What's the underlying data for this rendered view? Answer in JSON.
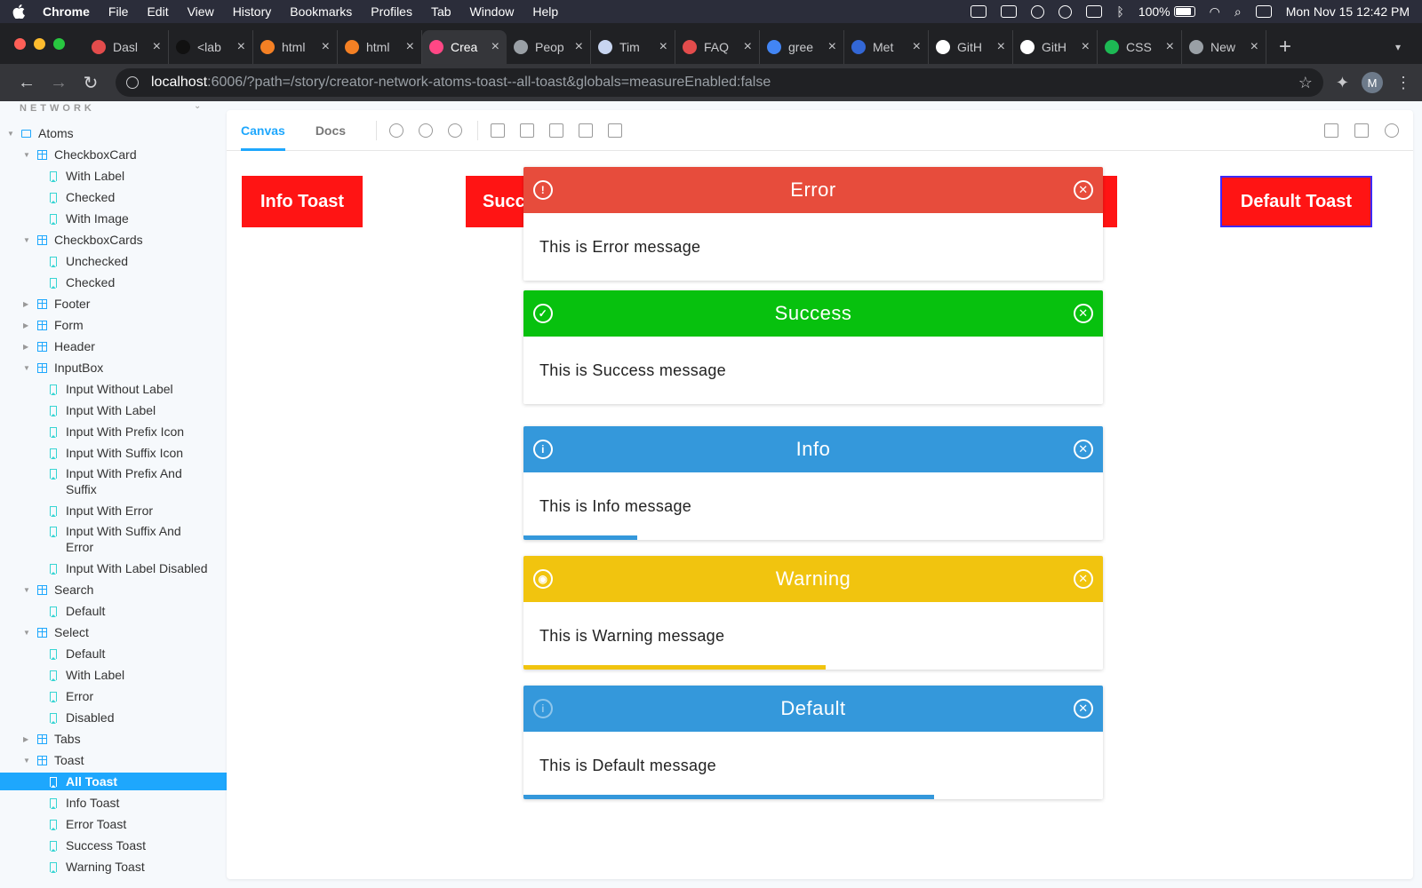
{
  "menubar": {
    "app": "Chrome",
    "items": [
      "File",
      "Edit",
      "View",
      "History",
      "Bookmarks",
      "Profiles",
      "Tab",
      "Window",
      "Help"
    ],
    "battery": "100%",
    "clock": "Mon Nov 15  12:42 PM"
  },
  "tabs": [
    {
      "title": "Dasl",
      "color": "#e34c4c"
    },
    {
      "title": "<lab",
      "color": "#111111"
    },
    {
      "title": "html",
      "color": "#f48024"
    },
    {
      "title": "html",
      "color": "#f48024"
    },
    {
      "title": "Crea",
      "color": "#ff4785",
      "active": true
    },
    {
      "title": "Peop",
      "color": "#9aa0a6"
    },
    {
      "title": "Tim",
      "color": "#c8d5f0"
    },
    {
      "title": "FAQ",
      "color": "#e34c4c"
    },
    {
      "title": "gree",
      "color": "#4285f4"
    },
    {
      "title": "Met",
      "color": "#3367d6"
    },
    {
      "title": "GitH",
      "color": "#ffffff"
    },
    {
      "title": "GitH",
      "color": "#ffffff"
    },
    {
      "title": "CSS",
      "color": "#1db954"
    },
    {
      "title": "New",
      "color": "#9aa0a6"
    }
  ],
  "address": {
    "host": "localhost",
    "path": ":6006/?path=/story/creator-network-atoms-toast--all-toast&globals=measureEnabled:false"
  },
  "avatar_letter": "M",
  "sidebar": {
    "heading": "NETWORK",
    "items": [
      {
        "label": "Atoms",
        "type": "folder",
        "level": 0,
        "expanded": true
      },
      {
        "label": "CheckboxCard",
        "type": "component",
        "level": 1,
        "expanded": true
      },
      {
        "label": "With Label",
        "type": "story",
        "level": 2
      },
      {
        "label": "Checked",
        "type": "story",
        "level": 2
      },
      {
        "label": "With Image",
        "type": "story",
        "level": 2
      },
      {
        "label": "CheckboxCards",
        "type": "component",
        "level": 1,
        "expanded": true
      },
      {
        "label": "Unchecked",
        "type": "story",
        "level": 2
      },
      {
        "label": "Checked",
        "type": "story",
        "level": 2
      },
      {
        "label": "Footer",
        "type": "component",
        "level": 1,
        "expanded": false
      },
      {
        "label": "Form",
        "type": "component",
        "level": 1,
        "expanded": false
      },
      {
        "label": "Header",
        "type": "component",
        "level": 1,
        "expanded": false
      },
      {
        "label": "InputBox",
        "type": "component",
        "level": 1,
        "expanded": true
      },
      {
        "label": "Input Without Label",
        "type": "story",
        "level": 2
      },
      {
        "label": "Input With Label",
        "type": "story",
        "level": 2
      },
      {
        "label": "Input With Prefix Icon",
        "type": "story",
        "level": 2
      },
      {
        "label": "Input With Suffix Icon",
        "type": "story",
        "level": 2
      },
      {
        "label": "Input With Prefix And Suffix",
        "type": "story",
        "level": 2,
        "multiline": true
      },
      {
        "label": "Input With Error",
        "type": "story",
        "level": 2
      },
      {
        "label": "Input With Suffix And Error",
        "type": "story",
        "level": 2,
        "multiline": true
      },
      {
        "label": "Input With Label Disabled",
        "type": "story",
        "level": 2
      },
      {
        "label": "Search",
        "type": "component",
        "level": 1,
        "expanded": true
      },
      {
        "label": "Default",
        "type": "story",
        "level": 2
      },
      {
        "label": "Select",
        "type": "component",
        "level": 1,
        "expanded": true
      },
      {
        "label": "Default",
        "type": "story",
        "level": 2
      },
      {
        "label": "With Label",
        "type": "story",
        "level": 2
      },
      {
        "label": "Error",
        "type": "story",
        "level": 2
      },
      {
        "label": "Disabled",
        "type": "story",
        "level": 2
      },
      {
        "label": "Tabs",
        "type": "component",
        "level": 1,
        "expanded": false
      },
      {
        "label": "Toast",
        "type": "component",
        "level": 1,
        "expanded": true
      },
      {
        "label": "All Toast",
        "type": "story",
        "level": 2,
        "selected": true
      },
      {
        "label": "Info Toast",
        "type": "story",
        "level": 2
      },
      {
        "label": "Error Toast",
        "type": "story",
        "level": 2
      },
      {
        "label": "Success Toast",
        "type": "story",
        "level": 2
      },
      {
        "label": "Warning Toast",
        "type": "story",
        "level": 2
      }
    ]
  },
  "storybook_toolbar": {
    "tabs": [
      "Canvas",
      "Docs"
    ],
    "active_tab": "Canvas"
  },
  "demo_buttons": {
    "info": "Info Toast",
    "success": "Succ",
    "default": "Default Toast"
  },
  "toasts": [
    {
      "title": "Error",
      "message": "This is Error message",
      "color": "#e74c3c",
      "icon": "exclamation-icon",
      "progress": 0
    },
    {
      "title": "Success",
      "message": "This is Success message",
      "color": "#07c10e",
      "icon": "check-icon",
      "progress": 0
    },
    {
      "title": "Info",
      "message": "This is Info message",
      "color": "#3498db",
      "icon": "info-icon",
      "progress": 0.196
    },
    {
      "title": "Warning",
      "message": "This is Warning message",
      "color": "#f1c40f",
      "icon": "broadcast-icon",
      "progress": 0.521
    },
    {
      "title": "Default",
      "message": "This is Default message",
      "color": "#3498db",
      "icon": "info-faded-icon",
      "progress": 0.709
    }
  ],
  "colors": {
    "accent": "#1ea7fd",
    "demo_button": "#ff1414",
    "default_button_border": "#3d2aff"
  }
}
